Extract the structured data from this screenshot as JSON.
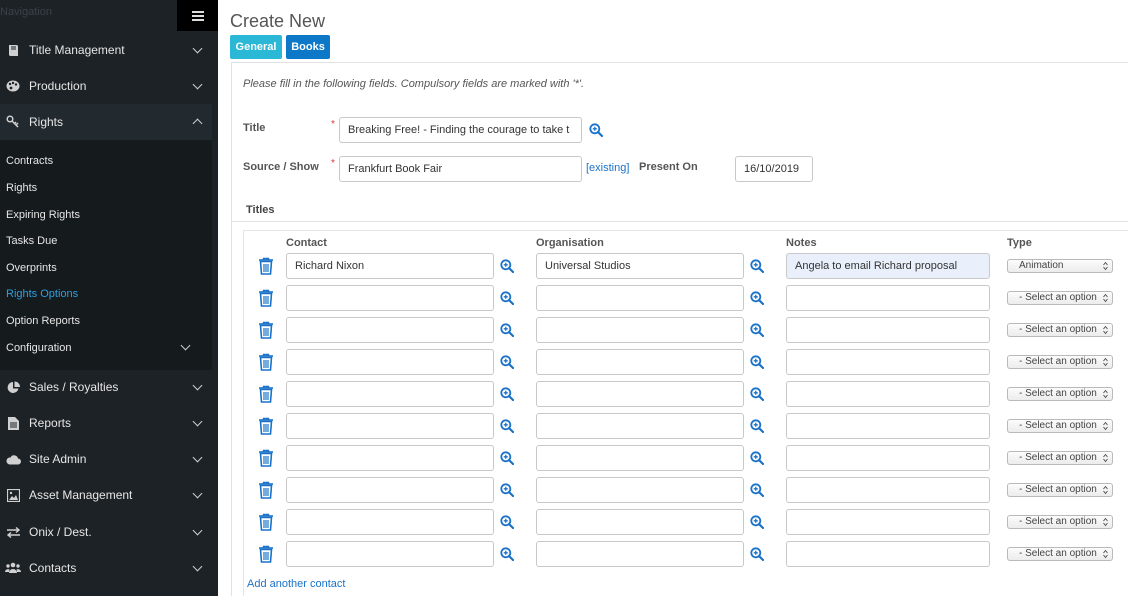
{
  "sidebar": {
    "title": "Navigation",
    "items": [
      {
        "label": "Title Management",
        "icon": "book-icon"
      },
      {
        "label": "Production",
        "icon": "palette-icon"
      },
      {
        "label": "Rights",
        "icon": "key-icon"
      },
      {
        "label": "Sales / Royalties",
        "icon": "pie-chart-icon"
      },
      {
        "label": "Reports",
        "icon": "file-icon"
      },
      {
        "label": "Site Admin",
        "icon": "cloud-icon"
      },
      {
        "label": "Asset Management",
        "icon": "image-icon"
      },
      {
        "label": "Onix / Dest.",
        "icon": "exchange-icon"
      },
      {
        "label": "Contacts",
        "icon": "users-icon"
      }
    ],
    "rights_sub": [
      {
        "label": "Contracts"
      },
      {
        "label": "Rights"
      },
      {
        "label": "Expiring Rights"
      },
      {
        "label": "Tasks Due"
      },
      {
        "label": "Overprints"
      },
      {
        "label": "Rights Options"
      },
      {
        "label": "Option Reports"
      },
      {
        "label": "Configuration"
      }
    ],
    "current_sub": "Rights Options"
  },
  "main": {
    "title": "Create New",
    "tabs": [
      "General",
      "Books"
    ],
    "instructions": "Please fill in the following fields. Compulsory fields are marked with '*'.",
    "form": {
      "title_label": "Title",
      "title_value": "Breaking Free! - Finding the courage to take t",
      "source_label": "Source / Show",
      "source_value": "Frankfurt Book Fair",
      "existing_link": "[existing]",
      "present_on_label": "Present On",
      "present_on_value": "16/10/2019",
      "required_mark": "*"
    },
    "titles_section": {
      "heading": "Titles",
      "columns": [
        "Contact",
        "Organisation",
        "Notes",
        "Type"
      ],
      "rows": [
        {
          "contact": "Richard Nixon",
          "organisation": "Universal Studios",
          "notes": "Angela to email Richard proposal",
          "type": "Animation"
        },
        {
          "contact": "",
          "organisation": "",
          "notes": "",
          "type": "- Select an option"
        },
        {
          "contact": "",
          "organisation": "",
          "notes": "",
          "type": "- Select an option"
        },
        {
          "contact": "",
          "organisation": "",
          "notes": "",
          "type": "- Select an option"
        },
        {
          "contact": "",
          "organisation": "",
          "notes": "",
          "type": "- Select an option"
        },
        {
          "contact": "",
          "organisation": "",
          "notes": "",
          "type": "- Select an option"
        },
        {
          "contact": "",
          "organisation": "",
          "notes": "",
          "type": "- Select an option"
        },
        {
          "contact": "",
          "organisation": "",
          "notes": "",
          "type": "- Select an option"
        },
        {
          "contact": "",
          "organisation": "",
          "notes": "",
          "type": "- Select an option"
        },
        {
          "contact": "",
          "organisation": "",
          "notes": "",
          "type": "- Select an option"
        }
      ],
      "add_link": "Add another contact"
    }
  },
  "colors": {
    "sidebar_bg": "#1d2226",
    "accent_blue": "#0d78c8",
    "tab_general": "#2ab8d6",
    "link": "#1a73c8",
    "required": "#dd3333"
  }
}
